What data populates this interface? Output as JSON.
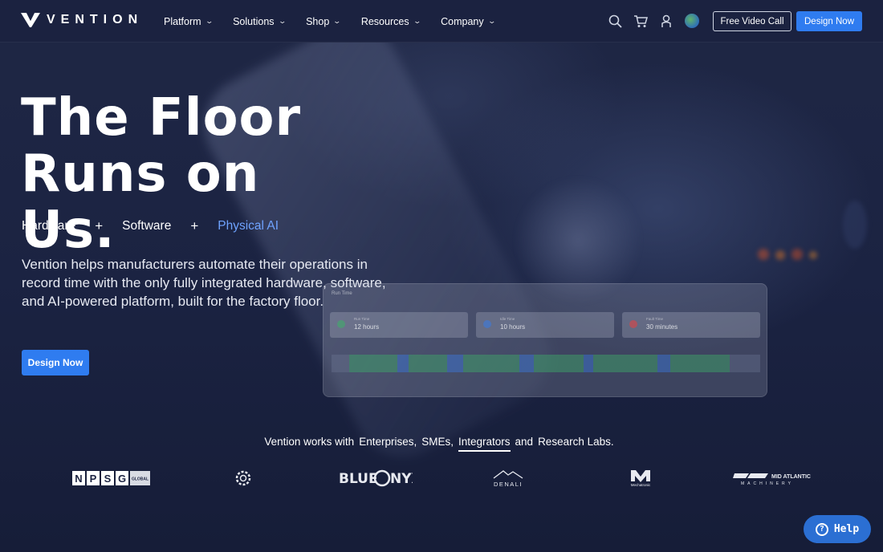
{
  "brand": {
    "name": "VENTION"
  },
  "nav": {
    "menu": [
      {
        "label": "Platform"
      },
      {
        "label": "Solutions"
      },
      {
        "label": "Shop"
      },
      {
        "label": "Resources"
      },
      {
        "label": "Company"
      }
    ],
    "icons": [
      "search-icon",
      "cart-icon",
      "user-icon",
      "globe-icon"
    ],
    "free_video_call": "Free Video Call",
    "design_now": "Design Now"
  },
  "hero": {
    "headline_line1": "The Floor",
    "headline_line2": "Runs on Us.",
    "pillars": [
      "Hardware",
      "Software",
      "Physical AI"
    ],
    "plus": "+",
    "description": "Vention helps manufacturers automate their operations in record time with the only fully integrated hardware, software, and AI-powered platform, built for the factory floor.",
    "cta": "Design Now"
  },
  "dashboard": {
    "title": "Run Time",
    "kpis": [
      {
        "label": "Run Time",
        "value": "12 hours",
        "color": "#3fae6a"
      },
      {
        "label": "Idle Time",
        "value": "10 hours",
        "color": "#3b7be0"
      },
      {
        "label": "Fault Time",
        "value": "30 minutes",
        "color": "#e04545"
      }
    ]
  },
  "works_with": {
    "prefix": "Vention works with",
    "items": [
      "Enterprises,",
      "SMEs,",
      "Integrators",
      "and",
      "Research Labs."
    ]
  },
  "client_logos": [
    "NPSG GLOBAL",
    "gear-logo",
    "BLUEONYX",
    "DENALI",
    "Mechatronic",
    "MID ATLANTIC MACHINERY"
  ],
  "help": {
    "label": "Help"
  },
  "colors": {
    "accent": "#2f7cf0",
    "active_pillar": "#6fa3ff"
  }
}
